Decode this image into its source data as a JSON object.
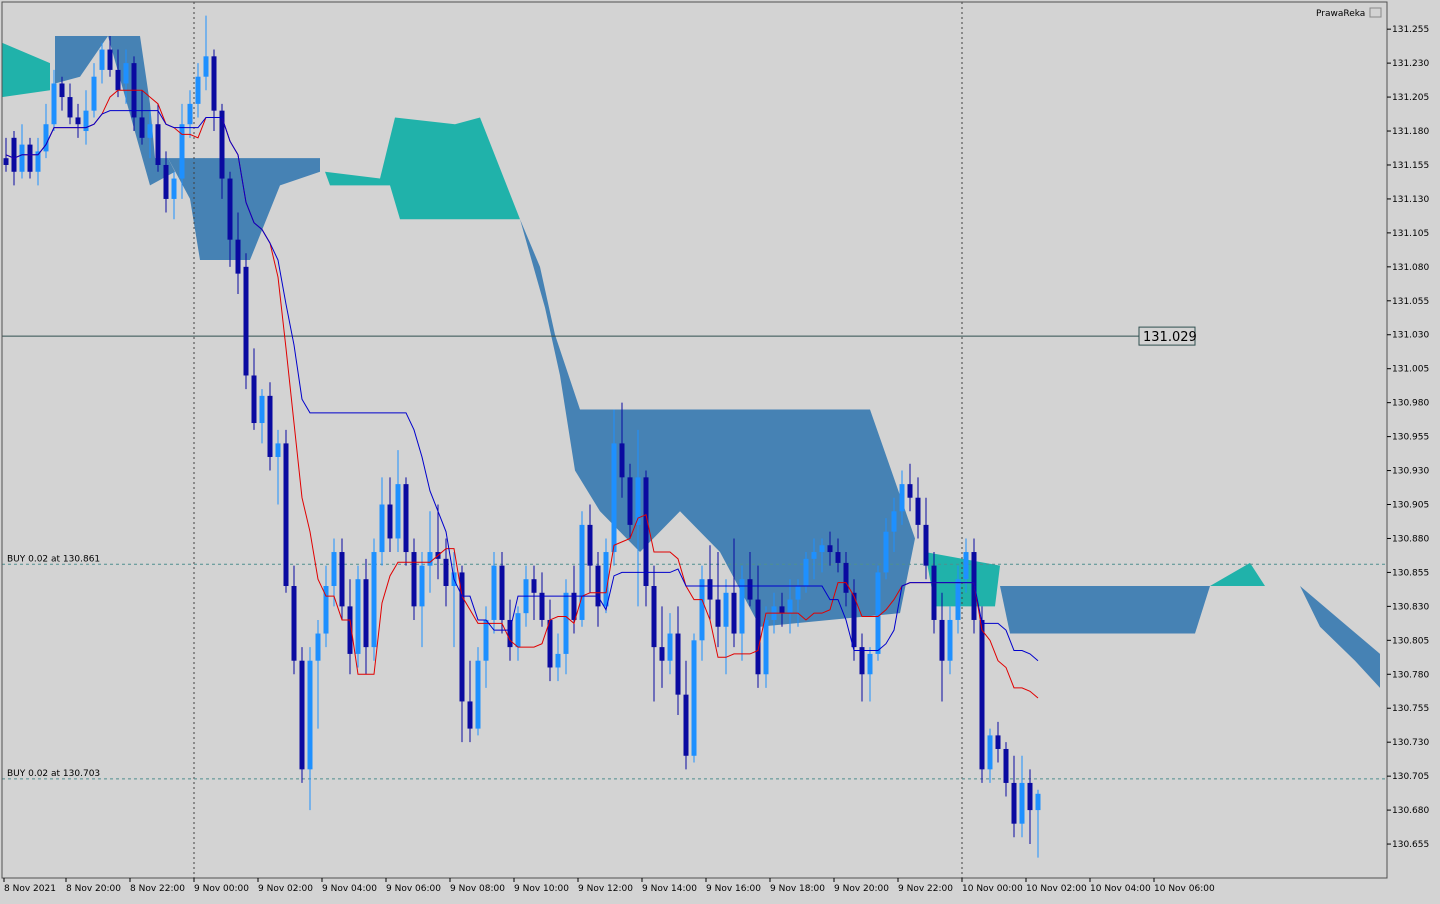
{
  "chart_data": {
    "type": "candlestick",
    "title": "",
    "indicator_label": "PrawaReka",
    "current_price_label": "131.029",
    "current_price": 131.029,
    "ylim": [
      130.63,
      131.275
    ],
    "y_ticks": [
      "131.255",
      "131.230",
      "131.205",
      "131.180",
      "131.155",
      "131.130",
      "131.105",
      "131.080",
      "131.055",
      "131.030",
      "131.005",
      "130.980",
      "130.955",
      "130.930",
      "130.905",
      "130.880",
      "130.855",
      "130.830",
      "130.805",
      "130.780",
      "130.755",
      "130.730",
      "130.705",
      "130.680",
      "130.655"
    ],
    "x_ticks": [
      "8 Nov 2021",
      "8 Nov 20:00",
      "8 Nov 22:00",
      "9 Nov 00:00",
      "9 Nov 02:00",
      "9 Nov 04:00",
      "9 Nov 06:00",
      "9 Nov 08:00",
      "9 Nov 10:00",
      "9 Nov 12:00",
      "9 Nov 14:00",
      "9 Nov 16:00",
      "9 Nov 18:00",
      "9 Nov 20:00",
      "9 Nov 22:00",
      "10 Nov 00:00",
      "10 Nov 02:00",
      "10 Nov 04:00",
      "10 Nov 06:00"
    ],
    "order_lines": [
      {
        "label": "BUY 0.02 at 130.861",
        "price": 130.861
      },
      {
        "label": "BUY 0.02 at 130.703",
        "price": 130.703
      }
    ],
    "grid": false,
    "colors": {
      "background": "#d3d3d3",
      "bull": "#1e90ff",
      "bear": "#0a0aa0",
      "bull_highlight": "#98fb98",
      "tenkan": "#e00000",
      "kijun": "#0000cc",
      "cloud_bull": "#20b2aa",
      "cloud_bear": "#4682b4",
      "order_line": "#4f8f8f",
      "price_line": "#2f4f4f"
    },
    "candles": [
      {
        "o": 131.16,
        "h": 131.175,
        "l": 131.15,
        "c": 131.155
      },
      {
        "o": 131.175,
        "h": 131.18,
        "l": 131.14,
        "c": 131.15
      },
      {
        "o": 131.15,
        "h": 131.185,
        "l": 131.145,
        "c": 131.17
      },
      {
        "o": 131.17,
        "h": 131.175,
        "l": 131.145,
        "c": 131.15
      },
      {
        "o": 131.15,
        "h": 131.175,
        "l": 131.14,
        "c": 131.165
      },
      {
        "o": 131.165,
        "h": 131.2,
        "l": 131.16,
        "c": 131.185
      },
      {
        "o": 131.185,
        "h": 131.225,
        "l": 131.18,
        "c": 131.215
      },
      {
        "o": 131.215,
        "h": 131.22,
        "l": 131.195,
        "c": 131.205
      },
      {
        "o": 131.205,
        "h": 131.215,
        "l": 131.185,
        "c": 131.19
      },
      {
        "o": 131.19,
        "h": 131.2,
        "l": 131.175,
        "c": 131.185
      },
      {
        "o": 131.18,
        "h": 131.21,
        "l": 131.17,
        "c": 131.195
      },
      {
        "o": 131.195,
        "h": 131.23,
        "l": 131.19,
        "c": 131.22
      },
      {
        "o": 131.225,
        "h": 131.245,
        "l": 131.215,
        "c": 131.24
      },
      {
        "o": 131.24,
        "h": 131.25,
        "l": 131.22,
        "c": 131.225
      },
      {
        "o": 131.225,
        "h": 131.24,
        "l": 131.205,
        "c": 131.21
      },
      {
        "o": 131.215,
        "h": 131.24,
        "l": 131.2,
        "c": 131.23
      },
      {
        "o": 131.23,
        "h": 131.235,
        "l": 131.18,
        "c": 131.19
      },
      {
        "o": 131.19,
        "h": 131.21,
        "l": 131.17,
        "c": 131.175
      },
      {
        "o": 131.175,
        "h": 131.195,
        "l": 131.16,
        "c": 131.185
      },
      {
        "o": 131.185,
        "h": 131.2,
        "l": 131.15,
        "c": 131.155
      },
      {
        "o": 131.155,
        "h": 131.165,
        "l": 131.12,
        "c": 131.13
      },
      {
        "o": 131.13,
        "h": 131.15,
        "l": 131.115,
        "c": 131.145
      },
      {
        "o": 131.145,
        "h": 131.2,
        "l": 131.13,
        "c": 131.185
      },
      {
        "o": 131.185,
        "h": 131.21,
        "l": 131.175,
        "c": 131.2
      },
      {
        "o": 131.2,
        "h": 131.23,
        "l": 131.19,
        "c": 131.22
      },
      {
        "o": 131.22,
        "h": 131.265,
        "l": 131.21,
        "c": 131.235
      },
      {
        "o": 131.235,
        "h": 131.24,
        "l": 131.18,
        "c": 131.195
      },
      {
        "o": 131.195,
        "h": 131.2,
        "l": 131.13,
        "c": 131.145
      },
      {
        "o": 131.145,
        "h": 131.15,
        "l": 131.08,
        "c": 131.1
      },
      {
        "o": 131.1,
        "h": 131.12,
        "l": 131.06,
        "c": 131.075
      },
      {
        "o": 131.08,
        "h": 131.09,
        "l": 130.99,
        "c": 131.0
      },
      {
        "o": 131.0,
        "h": 131.02,
        "l": 130.96,
        "c": 130.965
      },
      {
        "o": 130.965,
        "h": 130.99,
        "l": 130.95,
        "c": 130.985
      },
      {
        "o": 130.985,
        "h": 130.995,
        "l": 130.93,
        "c": 130.94
      },
      {
        "o": 130.94,
        "h": 130.96,
        "l": 130.905,
        "c": 130.95
      },
      {
        "o": 130.95,
        "h": 130.96,
        "l": 130.84,
        "c": 130.845
      },
      {
        "o": 130.845,
        "h": 130.86,
        "l": 130.78,
        "c": 130.79
      },
      {
        "o": 130.79,
        "h": 130.8,
        "l": 130.7,
        "c": 130.71
      },
      {
        "o": 130.71,
        "h": 130.8,
        "l": 130.68,
        "c": 130.79
      },
      {
        "o": 130.79,
        "h": 130.82,
        "l": 130.74,
        "c": 130.81
      },
      {
        "o": 130.81,
        "h": 130.86,
        "l": 130.8,
        "c": 130.845
      },
      {
        "o": 130.845,
        "h": 130.88,
        "l": 130.83,
        "c": 130.87
      },
      {
        "o": 130.87,
        "h": 130.88,
        "l": 130.82,
        "c": 130.83
      },
      {
        "o": 130.83,
        "h": 130.85,
        "l": 130.78,
        "c": 130.795
      },
      {
        "o": 130.795,
        "h": 130.86,
        "l": 130.785,
        "c": 130.85
      },
      {
        "o": 130.85,
        "h": 130.865,
        "l": 130.78,
        "c": 130.8
      },
      {
        "o": 130.8,
        "h": 130.88,
        "l": 130.79,
        "c": 130.87
      },
      {
        "o": 130.87,
        "h": 130.925,
        "l": 130.86,
        "c": 130.905
      },
      {
        "o": 130.905,
        "h": 130.925,
        "l": 130.87,
        "c": 130.88
      },
      {
        "o": 130.88,
        "h": 130.945,
        "l": 130.87,
        "c": 130.92
      },
      {
        "o": 130.92,
        "h": 130.925,
        "l": 130.86,
        "c": 130.87
      },
      {
        "o": 130.87,
        "h": 130.88,
        "l": 130.82,
        "c": 130.83
      },
      {
        "o": 130.83,
        "h": 130.87,
        "l": 130.8,
        "c": 130.86
      },
      {
        "o": 130.86,
        "h": 130.9,
        "l": 130.84,
        "c": 130.87
      },
      {
        "o": 130.87,
        "h": 130.905,
        "l": 130.85,
        "c": 130.865
      },
      {
        "o": 130.865,
        "h": 130.88,
        "l": 130.83,
        "c": 130.845
      },
      {
        "o": 130.845,
        "h": 130.87,
        "l": 130.8,
        "c": 130.855
      },
      {
        "o": 130.855,
        "h": 130.86,
        "l": 130.73,
        "c": 130.76
      },
      {
        "o": 130.76,
        "h": 130.79,
        "l": 130.73,
        "c": 130.74
      },
      {
        "o": 130.74,
        "h": 130.8,
        "l": 130.735,
        "c": 130.79
      },
      {
        "o": 130.79,
        "h": 130.83,
        "l": 130.77,
        "c": 130.82
      },
      {
        "o": 130.82,
        "h": 130.87,
        "l": 130.81,
        "c": 130.86
      },
      {
        "o": 130.86,
        "h": 130.87,
        "l": 130.81,
        "c": 130.82
      },
      {
        "o": 130.82,
        "h": 130.835,
        "l": 130.79,
        "c": 130.8
      },
      {
        "o": 130.8,
        "h": 130.83,
        "l": 130.79,
        "c": 130.825
      },
      {
        "o": 130.825,
        "h": 130.86,
        "l": 130.815,
        "c": 130.85
      },
      {
        "o": 130.85,
        "h": 130.86,
        "l": 130.82,
        "c": 130.84
      },
      {
        "o": 130.84,
        "h": 130.855,
        "l": 130.815,
        "c": 130.82
      },
      {
        "o": 130.82,
        "h": 130.835,
        "l": 130.775,
        "c": 130.785
      },
      {
        "o": 130.785,
        "h": 130.81,
        "l": 130.775,
        "c": 130.795
      },
      {
        "o": 130.795,
        "h": 130.85,
        "l": 130.78,
        "c": 130.84
      },
      {
        "o": 130.84,
        "h": 130.86,
        "l": 130.81,
        "c": 130.82
      },
      {
        "o": 130.82,
        "h": 130.9,
        "l": 130.815,
        "c": 130.89
      },
      {
        "o": 130.89,
        "h": 130.905,
        "l": 130.84,
        "c": 130.86
      },
      {
        "o": 130.86,
        "h": 130.87,
        "l": 130.815,
        "c": 130.83
      },
      {
        "o": 130.83,
        "h": 130.88,
        "l": 130.825,
        "c": 130.87
      },
      {
        "o": 130.87,
        "h": 130.975,
        "l": 130.86,
        "c": 130.95
      },
      {
        "o": 130.95,
        "h": 130.98,
        "l": 130.91,
        "c": 130.925
      },
      {
        "o": 130.925,
        "h": 130.935,
        "l": 130.88,
        "c": 130.89
      },
      {
        "o": 130.89,
        "h": 130.96,
        "l": 130.83,
        "c": 130.925
      },
      {
        "o": 130.925,
        "h": 130.93,
        "l": 130.83,
        "c": 130.845
      },
      {
        "o": 130.845,
        "h": 130.86,
        "l": 130.76,
        "c": 130.8
      },
      {
        "o": 130.8,
        "h": 130.83,
        "l": 130.77,
        "c": 130.79
      },
      {
        "o": 130.79,
        "h": 130.825,
        "l": 130.78,
        "c": 130.81
      },
      {
        "o": 130.81,
        "h": 130.83,
        "l": 130.75,
        "c": 130.765
      },
      {
        "o": 130.765,
        "h": 130.79,
        "l": 130.71,
        "c": 130.72
      },
      {
        "o": 130.72,
        "h": 130.81,
        "l": 130.715,
        "c": 130.805
      },
      {
        "o": 130.805,
        "h": 130.86,
        "l": 130.79,
        "c": 130.85
      },
      {
        "o": 130.85,
        "h": 130.875,
        "l": 130.82,
        "c": 130.835
      },
      {
        "o": 130.835,
        "h": 130.87,
        "l": 130.8,
        "c": 130.815
      },
      {
        "o": 130.815,
        "h": 130.85,
        "l": 130.78,
        "c": 130.84
      },
      {
        "o": 130.84,
        "h": 130.88,
        "l": 130.8,
        "c": 130.81
      },
      {
        "o": 130.81,
        "h": 130.86,
        "l": 130.79,
        "c": 130.85
      },
      {
        "o": 130.85,
        "h": 130.87,
        "l": 130.83,
        "c": 130.835
      },
      {
        "o": 130.835,
        "h": 130.86,
        "l": 130.77,
        "c": 130.78
      },
      {
        "o": 130.78,
        "h": 130.83,
        "l": 130.77,
        "c": 130.82
      },
      {
        "o": 130.82,
        "h": 130.84,
        "l": 130.81,
        "c": 130.83
      },
      {
        "o": 130.83,
        "h": 130.84,
        "l": 130.815,
        "c": 130.825
      },
      {
        "o": 130.825,
        "h": 130.85,
        "l": 130.81,
        "c": 130.835
      },
      {
        "o": 130.835,
        "h": 130.85,
        "l": 130.815,
        "c": 130.845
      },
      {
        "o": 130.845,
        "h": 130.87,
        "l": 130.84,
        "c": 130.865
      },
      {
        "o": 130.865,
        "h": 130.88,
        "l": 130.85,
        "c": 130.87
      },
      {
        "o": 130.87,
        "h": 130.88,
        "l": 130.855,
        "c": 130.875
      },
      {
        "o": 130.875,
        "h": 130.885,
        "l": 130.86,
        "c": 130.87
      },
      {
        "o": 130.87,
        "h": 130.88,
        "l": 130.855,
        "c": 130.862
      },
      {
        "o": 130.862,
        "h": 130.87,
        "l": 130.83,
        "c": 130.84
      },
      {
        "o": 130.84,
        "h": 130.85,
        "l": 130.79,
        "c": 130.8
      },
      {
        "o": 130.8,
        "h": 130.81,
        "l": 130.76,
        "c": 130.78
      },
      {
        "o": 130.78,
        "h": 130.8,
        "l": 130.76,
        "c": 130.795
      },
      {
        "o": 130.795,
        "h": 130.86,
        "l": 130.79,
        "c": 130.855
      },
      {
        "o": 130.855,
        "h": 130.895,
        "l": 130.85,
        "c": 130.885
      },
      {
        "o": 130.885,
        "h": 130.91,
        "l": 130.87,
        "c": 130.9
      },
      {
        "o": 130.9,
        "h": 130.93,
        "l": 130.89,
        "c": 130.92
      },
      {
        "o": 130.92,
        "h": 130.935,
        "l": 130.9,
        "c": 130.91
      },
      {
        "o": 130.91,
        "h": 130.925,
        "l": 130.88,
        "c": 130.89
      },
      {
        "o": 130.89,
        "h": 130.91,
        "l": 130.85,
        "c": 130.86
      },
      {
        "o": 130.86,
        "h": 130.87,
        "l": 130.81,
        "c": 130.82
      },
      {
        "o": 130.82,
        "h": 130.84,
        "l": 130.76,
        "c": 130.79
      },
      {
        "o": 130.79,
        "h": 130.83,
        "l": 130.78,
        "c": 130.82
      },
      {
        "o": 130.82,
        "h": 130.86,
        "l": 130.81,
        "c": 130.85
      },
      {
        "o": 130.85,
        "h": 130.88,
        "l": 130.84,
        "c": 130.87
      },
      {
        "o": 130.87,
        "h": 130.88,
        "l": 130.81,
        "c": 130.82
      },
      {
        "o": 130.82,
        "h": 130.83,
        "l": 130.7,
        "c": 130.71
      },
      {
        "o": 130.71,
        "h": 130.74,
        "l": 130.7,
        "c": 130.735
      },
      {
        "o": 130.735,
        "h": 130.745,
        "l": 130.715,
        "c": 130.725
      },
      {
        "o": 130.725,
        "h": 130.73,
        "l": 130.69,
        "c": 130.7
      },
      {
        "o": 130.7,
        "h": 130.72,
        "l": 130.66,
        "c": 130.67
      },
      {
        "o": 130.67,
        "h": 130.72,
        "l": 130.66,
        "c": 130.7
      },
      {
        "o": 130.7,
        "h": 130.71,
        "l": 130.655,
        "c": 130.68
      },
      {
        "o": 130.68,
        "h": 130.695,
        "l": 130.645,
        "c": 130.692
      }
    ]
  }
}
